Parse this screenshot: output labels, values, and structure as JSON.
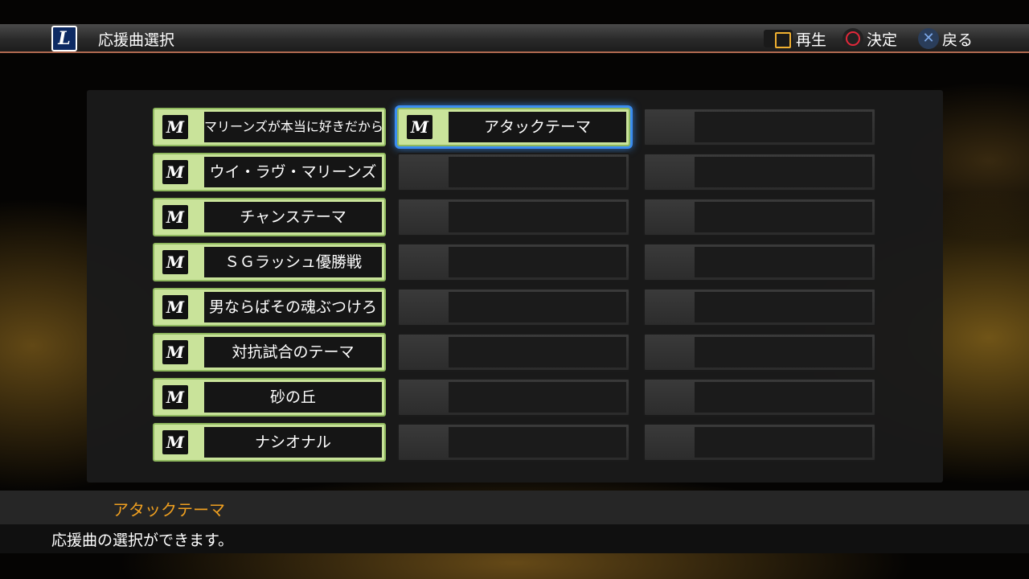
{
  "header": {
    "team_logo": "L",
    "title": "応援曲選択",
    "hints": [
      {
        "icon": "square-button-icon",
        "label": "再生"
      },
      {
        "icon": "circle-button-icon",
        "label": "決定"
      },
      {
        "icon": "cross-button-icon",
        "label": "戻る"
      }
    ]
  },
  "slots": {
    "icon_letter": "M",
    "column1": [
      "マリーンズが本当に好きだから",
      "ウイ・ラヴ・マリーンズ",
      "チャンステーマ",
      "ＳＧラッシュ優勝戦",
      "男ならばその魂ぶつけろ",
      "対抗試合のテーマ",
      "砂の丘",
      "ナシオナル"
    ],
    "column2": [
      "アタックテーマ",
      "",
      "",
      "",
      "",
      "",
      "",
      ""
    ],
    "column3": [
      "",
      "",
      "",
      "",
      "",
      "",
      "",
      ""
    ],
    "selected": "アタックテーマ"
  },
  "info": {
    "title": "アタックテーマ",
    "description": "応援曲の選択ができます。"
  },
  "colors": {
    "filled_slot": "#c9e39a",
    "selection_glow": "#3a8cf0",
    "info_title": "#f0a020"
  }
}
